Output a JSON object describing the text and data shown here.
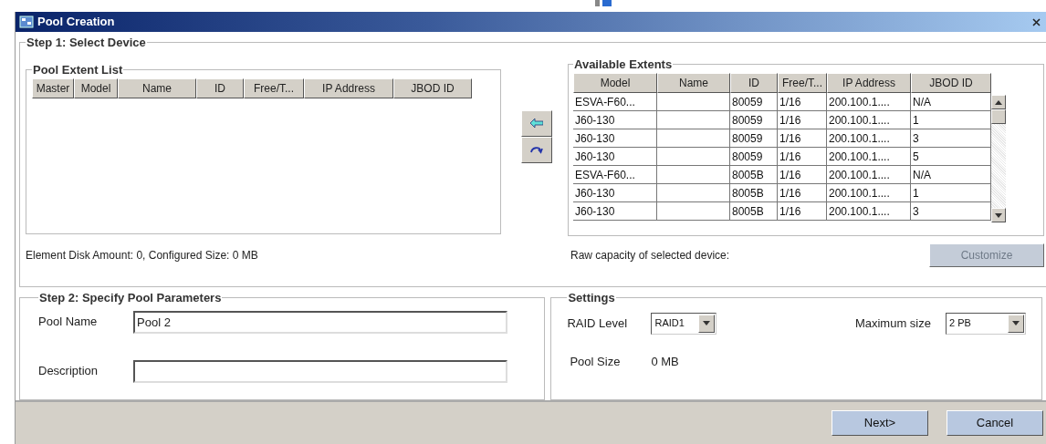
{
  "window": {
    "title": "Pool Creation"
  },
  "step1": {
    "title": "Step 1: Select Device",
    "pool_extent_list": {
      "title": "Pool Extent List",
      "columns": [
        "Master",
        "Model",
        "Name",
        "ID",
        "Free/T...",
        "IP Address",
        "JBOD ID"
      ]
    },
    "available_extents": {
      "title": "Available Extents",
      "columns": [
        "Model",
        "Name",
        "ID",
        "Free/T...",
        "IP Address",
        "JBOD ID"
      ],
      "rows": [
        [
          "ESVA-F60...",
          "",
          "80059",
          "1/16",
          "200.100.1....",
          "N/A"
        ],
        [
          "J60-130",
          "",
          "80059",
          "1/16",
          "200.100.1....",
          "1"
        ],
        [
          "J60-130",
          "",
          "80059",
          "1/16",
          "200.100.1....",
          "3"
        ],
        [
          "J60-130",
          "",
          "80059",
          "1/16",
          "200.100.1....",
          "5"
        ],
        [
          "ESVA-F60...",
          "",
          "8005B",
          "1/16",
          "200.100.1....",
          "N/A"
        ],
        [
          "J60-130",
          "",
          "8005B",
          "1/16",
          "200.100.1....",
          "1"
        ],
        [
          "J60-130",
          "",
          "8005B",
          "1/16",
          "200.100.1....",
          "3"
        ]
      ]
    },
    "summary": "Element Disk Amount: 0, Configured Size: 0 MB",
    "raw_capacity_label": "Raw capacity of selected device:",
    "customize_button": {
      "label": "Customize",
      "disabled": true
    }
  },
  "step2": {
    "title": "Step 2: Specify Pool Parameters",
    "fields": [
      {
        "label": "Pool Name",
        "value": "Pool 2"
      },
      {
        "label": "Description"
      }
    ]
  },
  "settings": {
    "title": "Settings",
    "raid_level": {
      "label": "RAID Level",
      "value": "RAID1"
    },
    "maximum_size": {
      "label": "Maximum size",
      "value": "2 PB"
    },
    "pool_size": {
      "label": "Pool Size",
      "value": "0 MB"
    }
  },
  "buttons": [
    "Next>",
    "Cancel"
  ]
}
